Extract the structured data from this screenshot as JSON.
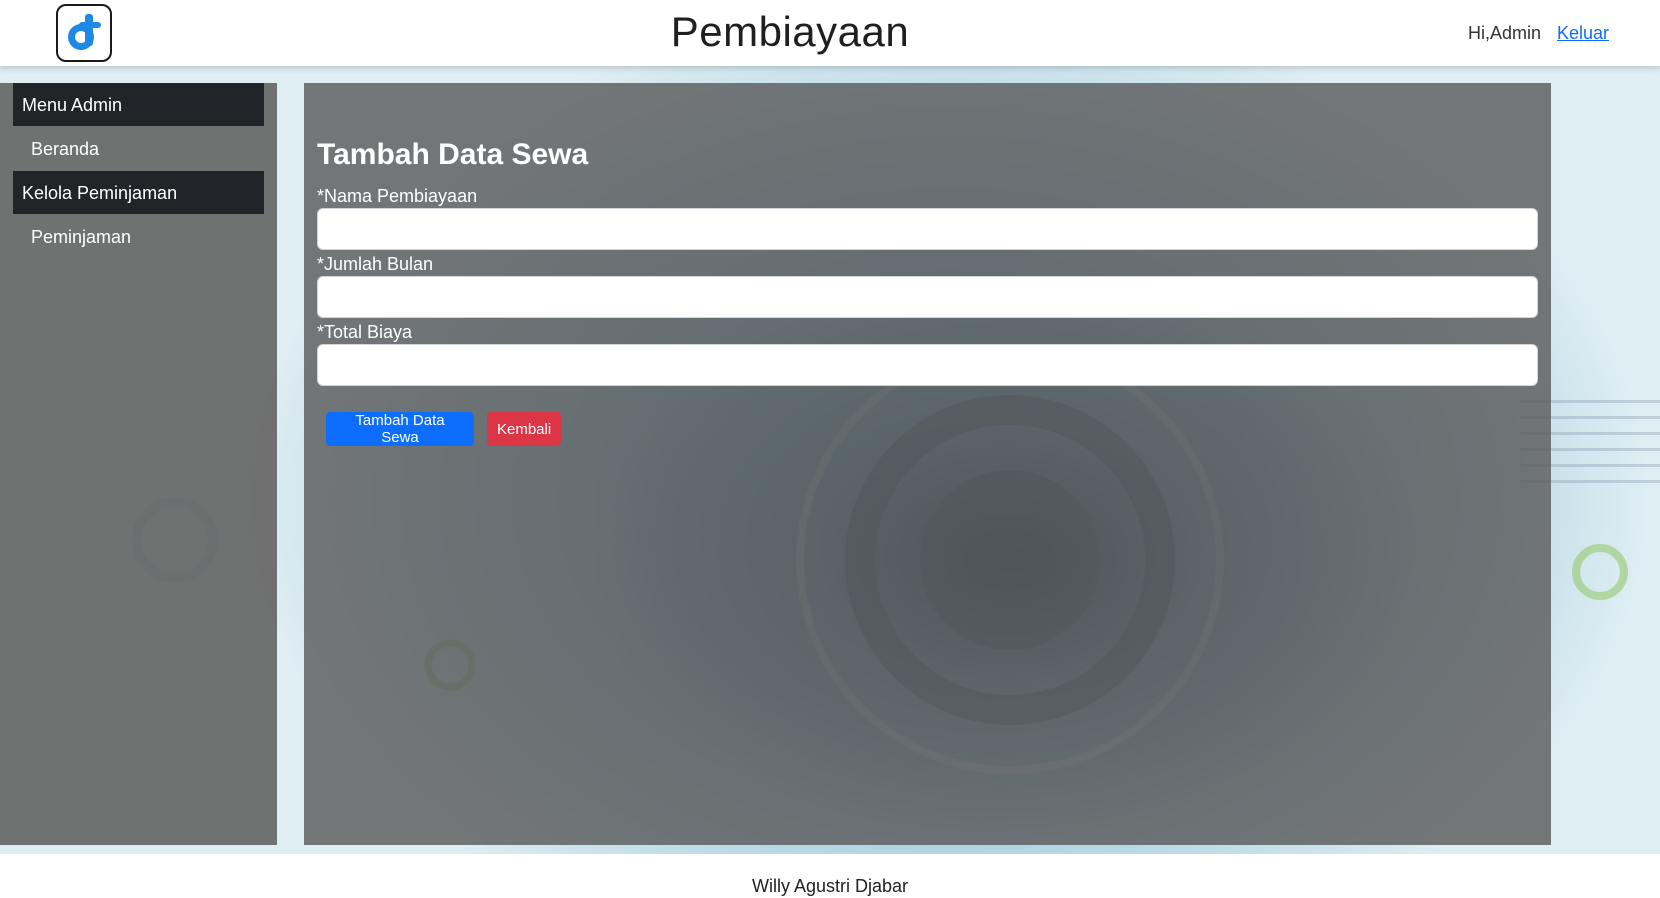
{
  "header": {
    "title": "Pembiayaan",
    "greeting": "Hi,Admin",
    "logout_label": "Keluar"
  },
  "sidebar": {
    "sections": [
      {
        "heading": "Menu Admin",
        "link": "Beranda"
      },
      {
        "heading": "Kelola Peminjaman",
        "link": "Peminjaman"
      }
    ]
  },
  "form": {
    "title": "Tambah Data Sewa",
    "fields": [
      {
        "label": "*Nama Pembiayaan",
        "value": "",
        "placeholder": ""
      },
      {
        "label": "*Jumlah Bulan",
        "value": "",
        "placeholder": ""
      },
      {
        "label": "*Total Biaya",
        "value": "",
        "placeholder": ""
      }
    ],
    "submit_label": "Tambah Data Sewa",
    "back_label": "Kembali"
  },
  "footer": {
    "text": "Willy Agustri Djabar"
  },
  "colors": {
    "primary": "#0d6efd",
    "danger": "#dc3545",
    "menu_dark": "#212529"
  },
  "icons": {
    "logo": "app-logo-icon"
  }
}
